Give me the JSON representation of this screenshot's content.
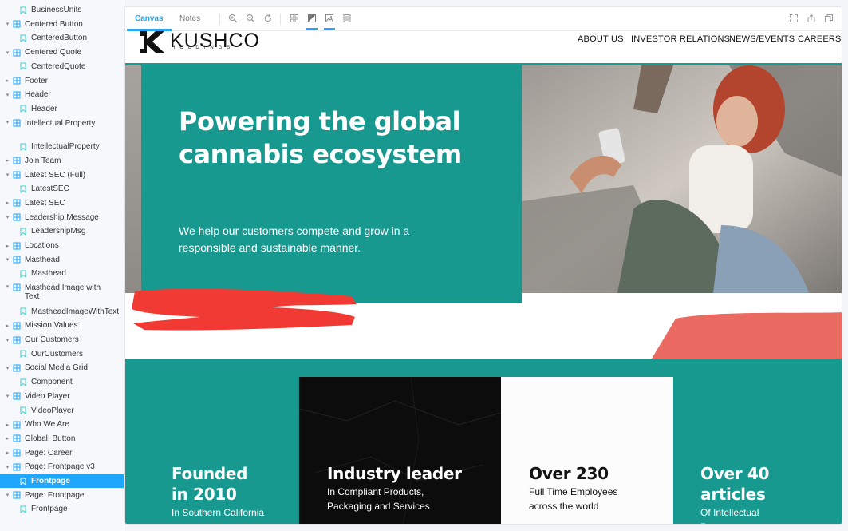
{
  "sidebar": {
    "items": [
      {
        "label": "BusinessUnits",
        "type": "story"
      },
      {
        "label": "Centered Button",
        "type": "component"
      },
      {
        "label": "CenteredButton",
        "type": "story"
      },
      {
        "label": "Centered Quote",
        "type": "component"
      },
      {
        "label": "CenteredQuote",
        "type": "story"
      },
      {
        "label": "Footer",
        "type": "component-collapsed"
      },
      {
        "label": "Header",
        "type": "component"
      },
      {
        "label": "Header",
        "type": "story"
      },
      {
        "label": "Intellectual Property",
        "type": "component"
      },
      {
        "label": "IntellectualProperty",
        "type": "story"
      },
      {
        "label": "Join Team",
        "type": "component-collapsed"
      },
      {
        "label": "Latest SEC (Full)",
        "type": "component"
      },
      {
        "label": "LatestSEC",
        "type": "story"
      },
      {
        "label": "Latest SEC",
        "type": "component-collapsed"
      },
      {
        "label": "Leadership Message",
        "type": "component"
      },
      {
        "label": "LeadershipMsg",
        "type": "story"
      },
      {
        "label": "Locations",
        "type": "component-collapsed"
      },
      {
        "label": "Masthead",
        "type": "component"
      },
      {
        "label": "Masthead",
        "type": "story"
      },
      {
        "label": "Masthead Image with Text",
        "type": "component"
      },
      {
        "label": "MastheadImageWithText",
        "type": "story"
      },
      {
        "label": "Mission Values",
        "type": "component-collapsed"
      },
      {
        "label": "Our Customers",
        "type": "component"
      },
      {
        "label": "OurCustomers",
        "type": "story"
      },
      {
        "label": "Social Media Grid",
        "type": "component"
      },
      {
        "label": "Component",
        "type": "story"
      },
      {
        "label": "Video Player",
        "type": "component"
      },
      {
        "label": "VideoPlayer",
        "type": "story"
      },
      {
        "label": "Who We Are",
        "type": "component-collapsed"
      },
      {
        "label": "Global: Button",
        "type": "component-collapsed"
      },
      {
        "label": "Page: Career",
        "type": "component-collapsed"
      },
      {
        "label": "Page: Frontpage v3",
        "type": "component"
      },
      {
        "label": "Frontpage",
        "type": "story",
        "selected": true
      },
      {
        "label": "Page: Frontpage",
        "type": "component"
      },
      {
        "label": "Frontpage",
        "type": "story"
      }
    ]
  },
  "toolbar": {
    "tab_canvas": "Canvas",
    "tab_notes": "Notes"
  },
  "site": {
    "logo_word": "KUSHCO",
    "logo_sub": "HOLDINGS",
    "nav": [
      "ABOUT US",
      "INVESTOR RELATIONS",
      "NEWS/EVENTS",
      "CAREERS"
    ],
    "hero_title": "Powering the global cannabis ecosystem",
    "hero_subtitle": "We help our customers compete and grow in a responsible and sustainable manner.",
    "stats": [
      {
        "title": "Founded in 2010",
        "desc": "In Southern California"
      },
      {
        "title": "Industry leader",
        "desc": "In Compliant Products, Packaging and Services"
      },
      {
        "title": "Over 230",
        "desc": "Full Time Employees across the world"
      },
      {
        "title": "Over 40 articles",
        "desc": "Of Intellectual Property"
      }
    ]
  },
  "colors": {
    "accent": "#1ea7fd",
    "teal": "#17998f",
    "brush_red": "#f03a33",
    "salmon": "#ea6a62"
  }
}
